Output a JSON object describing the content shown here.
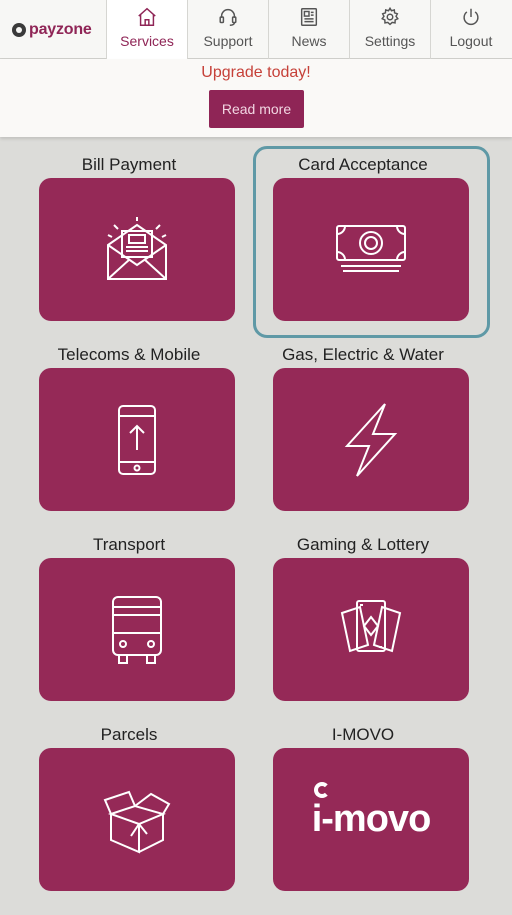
{
  "brand": {
    "logo_text": "payzone",
    "accent": "#952957"
  },
  "nav": {
    "items": [
      {
        "label": "Services",
        "icon": "home-icon",
        "active": true
      },
      {
        "label": "Support",
        "icon": "headset-icon"
      },
      {
        "label": "News",
        "icon": "newspaper-icon"
      },
      {
        "label": "Settings",
        "icon": "gear-icon"
      },
      {
        "label": "Logout",
        "icon": "power-icon"
      }
    ]
  },
  "banner": {
    "text": "Upgrade today!",
    "button": "Read more",
    "text_color": "#c64139"
  },
  "services": [
    {
      "title": "Bill Payment",
      "icon": "envelope-bill-icon"
    },
    {
      "title": "Card Acceptance",
      "icon": "banknote-icon",
      "selected": true
    },
    {
      "title": "Telecoms & Mobile",
      "icon": "mobile-phone-icon"
    },
    {
      "title": "Gas, Electric & Water",
      "icon": "lightning-icon"
    },
    {
      "title": "Transport",
      "icon": "bus-icon"
    },
    {
      "title": "Gaming & Lottery",
      "icon": "playing-cards-icon"
    },
    {
      "title": "Parcels",
      "icon": "box-icon"
    },
    {
      "title": "I-MOVO",
      "icon": "i-movo-logo",
      "logo_text": "i-movo"
    }
  ]
}
